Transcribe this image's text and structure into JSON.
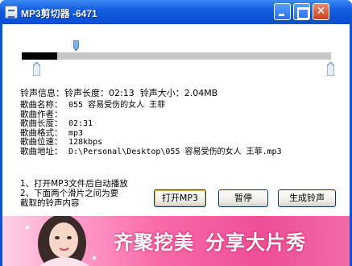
{
  "window": {
    "title": "MP3剪切器 -6471",
    "controls": {
      "minimize": "minimize",
      "maximize": "maximize",
      "close": "✕"
    }
  },
  "slider": {
    "played_fraction": 0.115,
    "colors": {
      "track": "#c7c7c7",
      "fill": "#000000"
    }
  },
  "ringtone": {
    "label": "铃声信息：",
    "length_label": "铃声长度：",
    "length": "02:13",
    "size_label": "铃声大小：",
    "size": "2.04MB"
  },
  "song": {
    "name_label": "歌曲名称：",
    "name": "055 容易受伤的女人 王菲",
    "author_label": "歌曲作者：",
    "author": "",
    "length_label": "歌曲长度：",
    "length": "02:31",
    "format_label": "歌曲格式：",
    "format": "mp3",
    "bitrate_label": "歌曲位速：",
    "bitrate": "128kbps",
    "path_label": "歌曲地址：",
    "path": "D:\\Personal\\Desktop\\055 容易受伤的女人 王菲.mp3"
  },
  "tips": [
    "1、打开MP3文件后自动播放",
    "2、下面两个滑片之间为要",
    "截取的铃声内容"
  ],
  "buttons": {
    "open": "打开MP3",
    "pause": "暂停",
    "make": "生成铃声"
  },
  "banner": {
    "text_a": "齐聚挖美",
    "text_b": "分享大片秀",
    "accent": "#ee4f96"
  }
}
